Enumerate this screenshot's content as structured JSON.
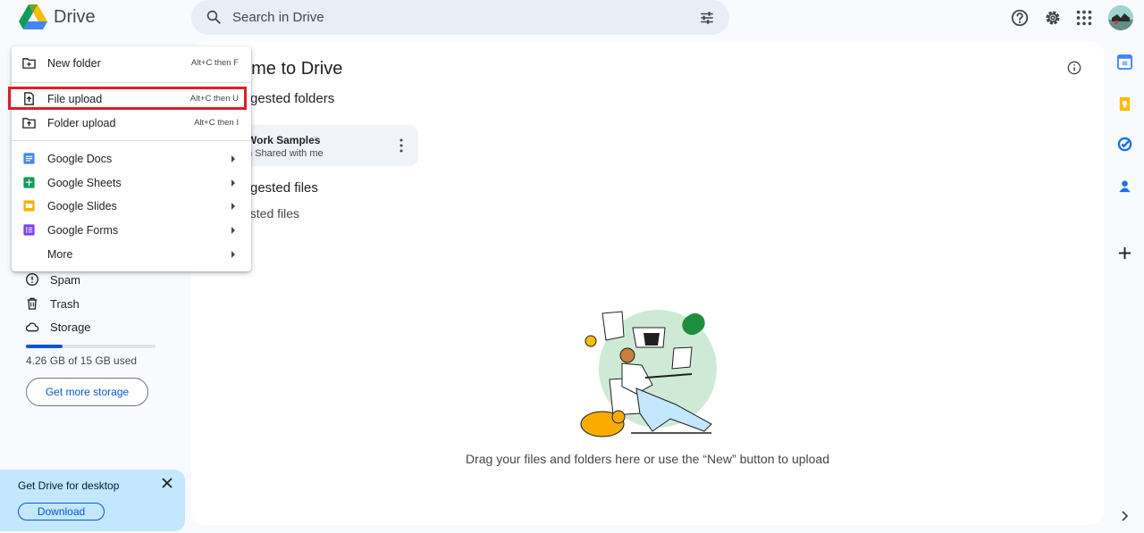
{
  "app": {
    "name": "Drive"
  },
  "search": {
    "placeholder": "Search in Drive"
  },
  "main": {
    "title": "ome to Drive",
    "suggested_folders_title": "gested folders",
    "folder": {
      "name": "Work Samples",
      "subtitle": "n Shared with me"
    },
    "suggested_files_title": "gested files",
    "suggested_files_empty": "ested files",
    "drop_hint": "Drag your files and folders here or use the “New” button to upload"
  },
  "sidebar": {
    "items": [
      {
        "label": "Spam",
        "icon": "spam-icon"
      },
      {
        "label": "Trash",
        "icon": "trash-icon"
      },
      {
        "label": "Storage",
        "icon": "cloud-icon"
      }
    ],
    "storage": {
      "used_text": "4.26 GB of 15 GB used",
      "used_fraction": 0.284,
      "button_label": "Get more storage"
    }
  },
  "promo": {
    "title": "Get Drive for desktop",
    "button_label": "Download"
  },
  "new_menu": {
    "items": [
      {
        "label": "New folder",
        "shortcut": "Alt+C then F",
        "icon": "new-folder-icon"
      },
      {
        "label": "File upload",
        "shortcut": "Alt+C then U",
        "icon": "file-upload-icon",
        "highlighted": true
      },
      {
        "label": "Folder upload",
        "shortcut": "Alt+C then I",
        "icon": "folder-upload-icon"
      },
      {
        "label": "Google Docs",
        "icon": "google-docs-icon",
        "submenu": true
      },
      {
        "label": "Google Sheets",
        "icon": "google-sheets-icon",
        "submenu": true
      },
      {
        "label": "Google Slides",
        "icon": "google-slides-icon",
        "submenu": true
      },
      {
        "label": "Google Forms",
        "icon": "google-forms-icon",
        "submenu": true
      },
      {
        "label": "More",
        "submenu": true
      }
    ]
  },
  "colors": {
    "accent": "#0b57d0",
    "highlight_border": "#d9202a",
    "docs": "#4285f4",
    "sheets": "#0f9d58",
    "slides": "#f4b400",
    "forms": "#7e3ff2"
  }
}
